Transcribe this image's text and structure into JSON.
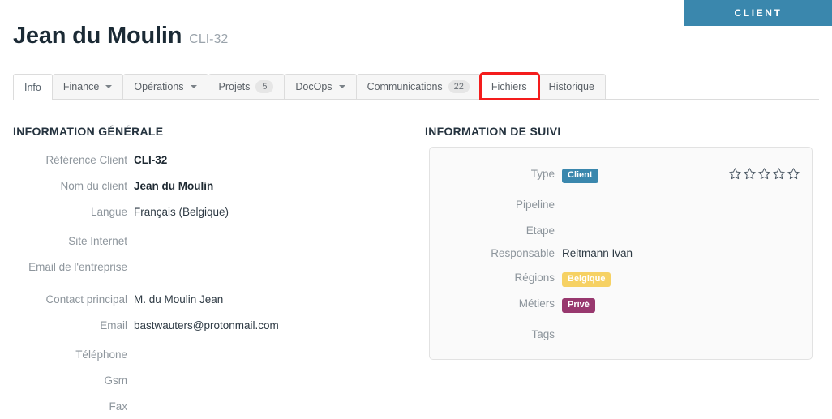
{
  "ribbon": {
    "label": "CLIENT",
    "color": "#3a87ad"
  },
  "header": {
    "title": "Jean du Moulin",
    "reference": "CLI-32"
  },
  "tabs": [
    {
      "label": "Info",
      "active": true,
      "caret": false,
      "count": null,
      "highlighted": false
    },
    {
      "label": "Finance",
      "active": false,
      "caret": true,
      "count": null,
      "highlighted": false
    },
    {
      "label": "Opérations",
      "active": false,
      "caret": true,
      "count": null,
      "highlighted": false
    },
    {
      "label": "Projets",
      "active": false,
      "caret": false,
      "count": "5",
      "highlighted": false
    },
    {
      "label": "DocOps",
      "active": false,
      "caret": true,
      "count": null,
      "highlighted": false
    },
    {
      "label": "Communications",
      "active": false,
      "caret": false,
      "count": "22",
      "highlighted": false
    },
    {
      "label": "Fichiers",
      "active": false,
      "caret": false,
      "count": null,
      "highlighted": true
    },
    {
      "label": "Historique",
      "active": false,
      "caret": false,
      "count": null,
      "highlighted": false
    }
  ],
  "highlight_color": "#f41d1d",
  "general": {
    "section_title": "INFORMATION GÉNÉRALE",
    "rows": [
      {
        "label": "Référence Client",
        "value": "CLI-32",
        "bold": true
      },
      {
        "label": "Nom du client",
        "value": "Jean du Moulin",
        "bold": true
      },
      {
        "label": "Langue",
        "value": "Français (Belgique)",
        "bold": false
      },
      {
        "label": "Site Internet",
        "value": "",
        "bold": false
      },
      {
        "label": "Email de l'entreprise",
        "value": "",
        "bold": false
      },
      {
        "label": "Contact principal",
        "value": "M. du Moulin Jean",
        "bold": false
      },
      {
        "label": "Email",
        "value": "bastwauters@protonmail.com",
        "bold": false
      },
      {
        "label": "Téléphone",
        "value": "",
        "bold": false
      },
      {
        "label": "Gsm",
        "value": "",
        "bold": false
      },
      {
        "label": "Fax",
        "value": "",
        "bold": false
      }
    ]
  },
  "suivi": {
    "section_title": "INFORMATION DE SUIVI",
    "rows": [
      {
        "label": "Type",
        "value": "Client",
        "badge": "type"
      },
      {
        "label": "Pipeline",
        "value": "",
        "badge": null
      },
      {
        "label": "Etape",
        "value": "",
        "badge": null
      },
      {
        "label": "Responsable",
        "value": "Reitmann Ivan",
        "badge": null
      },
      {
        "label": "Régions",
        "value": "Belgique",
        "badge": "region"
      },
      {
        "label": "Métiers",
        "value": "Privé",
        "badge": "metier"
      },
      {
        "label": "Tags",
        "value": "",
        "badge": null
      }
    ],
    "rating": {
      "total": 5,
      "filled": 0
    },
    "badge_colors": {
      "type": "#3a87ad",
      "region": "#f6d163",
      "metier": "#98386e"
    }
  }
}
